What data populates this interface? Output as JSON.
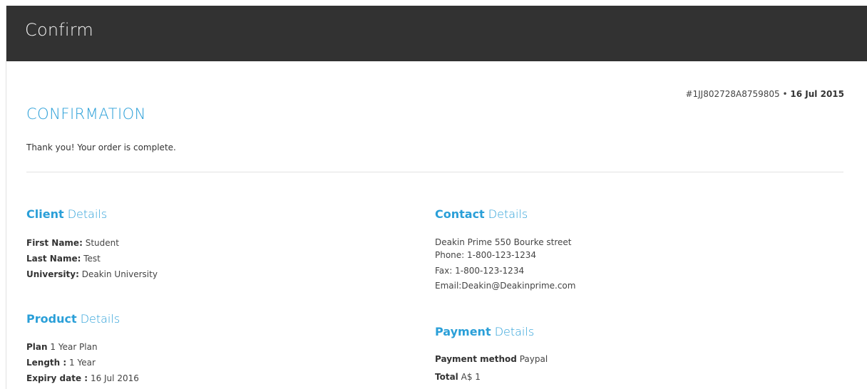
{
  "header": {
    "title": "Confirm"
  },
  "order": {
    "id": "#1JJ802728A8759805",
    "separator": "•",
    "date": "16 Jul 2015"
  },
  "confirmation": {
    "heading": "CONFIRMATION",
    "message": "Thank you! Your order is complete."
  },
  "client": {
    "title_bold": "Client",
    "title_light": "Details",
    "fields": [
      {
        "label": "First Name:",
        "value": "Student"
      },
      {
        "label": "Last Name:",
        "value": "Test"
      },
      {
        "label": "University:",
        "value": "Deakin University"
      }
    ]
  },
  "product": {
    "title_bold": "Product",
    "title_light": "Details",
    "fields": [
      {
        "label": "Plan",
        "value": "1 Year Plan"
      },
      {
        "label": "Length :",
        "value": "1 Year"
      },
      {
        "label": "Expiry date :",
        "value": "16 Jul 2016"
      }
    ]
  },
  "contact": {
    "title_bold": "Contact",
    "title_light": "Details",
    "lines": [
      "Deakin Prime 550 Bourke street",
      "Phone: 1-800-123-1234",
      "Fax: 1-800-123-1234",
      "Email:Deakin@Deakinprime.com"
    ]
  },
  "payment": {
    "title_bold": "Payment",
    "title_light": "Details",
    "fields": [
      {
        "label": "Payment method",
        "value": "Paypal"
      },
      {
        "label": "Total",
        "value": "A$ 1"
      }
    ]
  },
  "colors": {
    "header_bg": "#323232",
    "accent": "#2a9fd8"
  }
}
